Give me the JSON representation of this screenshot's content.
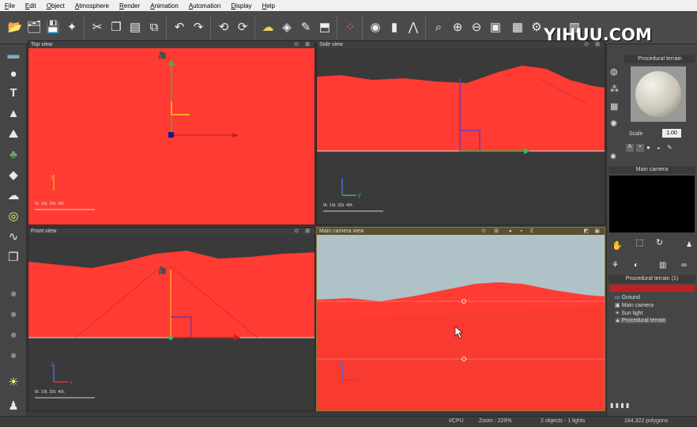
{
  "menu": [
    "File",
    "Edit",
    "Object",
    "Atmosphere",
    "Render",
    "Animation",
    "Automation",
    "Display",
    "Help"
  ],
  "watermark": "YIHUU.COM",
  "toolbar": {
    "icons": [
      "open-icon",
      "save-as-icon",
      "save-icon",
      "wizard-icon",
      "cut-icon",
      "copy-icon",
      "paste-icon",
      "duplicate-icon",
      "undo-icon",
      "redo-icon",
      "link-icon",
      "unlink-icon",
      "cloud-icon",
      "material-icon",
      "edit-icon",
      "drop-icon",
      "palette-icon",
      "render-icon",
      "graph-icon",
      "animation-icon",
      "zoom-icon",
      "zoom-in-icon",
      "zoom-out-icon",
      "fit-icon",
      "film-icon",
      "settings-icon",
      "display-icon"
    ]
  },
  "viewports": {
    "top": {
      "title": "Top view",
      "scale": "0t.  10t.  20t.        40t.",
      "axis_y": "y"
    },
    "side": {
      "title": "Side view",
      "scale": "0t.  10t.  20t.        40t.",
      "axis_y": "z",
      "axis_x": "y"
    },
    "front": {
      "title": "Front view",
      "scale": "0t.  10t.  20t.        40t.",
      "axis_y": "z",
      "axis_x": "x"
    },
    "camera": {
      "title": "Main camera view",
      "z_label": "Z",
      "axis_y": "z",
      "axis_x": "x"
    }
  },
  "right_panel": {
    "title": "Procedural terrain",
    "scale_label": "Scale",
    "scale_value": "1.00",
    "camera_header": "Main camera",
    "list_header": "Procedural terrain (1)",
    "tree": [
      "Ground",
      "Main camera",
      "Sun light",
      "Procedural terrain"
    ]
  },
  "status": {
    "cpu": "I/CPU",
    "zoom": "Zoom : 229%",
    "objects": "2 objects - 1 lights",
    "polygons": "184,322 polygons"
  },
  "colors": {
    "terrain": "#ff3b33",
    "sky": "#aec2c7",
    "panel": "#454545",
    "selected_frame": "#8a7a3a"
  }
}
